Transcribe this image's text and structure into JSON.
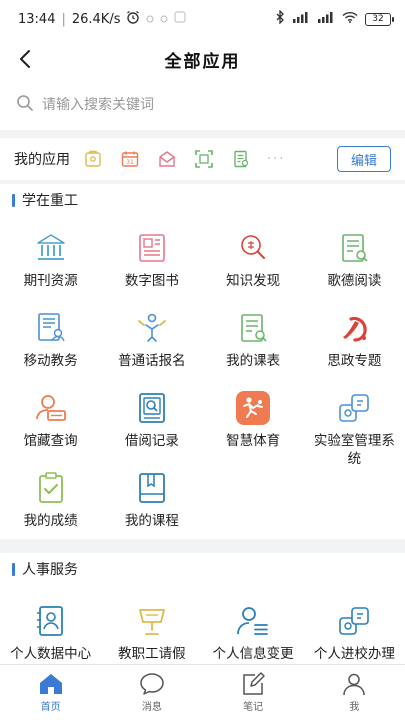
{
  "status_bar": {
    "time": "13:44",
    "speed": "26.4K/s",
    "battery": "32"
  },
  "header": {
    "title": "全部应用"
  },
  "search": {
    "placeholder": "请输入搜索关键词"
  },
  "my_apps": {
    "label": "我的应用",
    "edit_label": "编辑",
    "more": "···"
  },
  "sections": [
    {
      "title": "学在重工",
      "apps": [
        {
          "label": "期刊资源",
          "icon": "bank-icon"
        },
        {
          "label": "数字图书",
          "icon": "digital-book-icon"
        },
        {
          "label": "知识发现",
          "icon": "knowledge-search-icon"
        },
        {
          "label": "歌德阅读",
          "icon": "reading-icon"
        },
        {
          "label": "移动教务",
          "icon": "academic-affairs-icon"
        },
        {
          "label": "普通话报名",
          "icon": "mandarin-signup-icon"
        },
        {
          "label": "我的课表",
          "icon": "timetable-icon"
        },
        {
          "label": "思政专题",
          "icon": "party-emblem-icon"
        },
        {
          "label": "馆藏查询",
          "icon": "collection-query-icon"
        },
        {
          "label": "借阅记录",
          "icon": "borrow-record-icon"
        },
        {
          "label": "智慧体育",
          "icon": "smart-sports-icon"
        },
        {
          "label": "实验室管理系统",
          "icon": "lab-management-icon"
        },
        {
          "label": "我的成绩",
          "icon": "grades-icon"
        },
        {
          "label": "我的课程",
          "icon": "courses-icon"
        }
      ]
    },
    {
      "title": "人事服务",
      "apps": [
        {
          "label": "个人数据中心",
          "icon": "personal-data-icon"
        },
        {
          "label": "教职工请假",
          "icon": "staff-leave-icon"
        },
        {
          "label": "个人信息变更",
          "icon": "info-change-icon"
        },
        {
          "label": "个人进校办理",
          "icon": "campus-entry-icon"
        }
      ]
    }
  ],
  "tabs": [
    {
      "label": "首页",
      "icon": "home-icon",
      "active": true
    },
    {
      "label": "消息",
      "icon": "message-icon",
      "active": false
    },
    {
      "label": "笔记",
      "icon": "note-icon",
      "active": false
    },
    {
      "label": "我",
      "icon": "profile-icon",
      "active": false
    }
  ],
  "colors": {
    "accent": "#3a7bd5",
    "icon_blue": "#4a90d9",
    "icon_pink": "#e8758a",
    "icon_green": "#6bb36b",
    "icon_orange": "#ef7b52",
    "icon_yellow": "#e0b94a",
    "icon_red": "#d9433a"
  }
}
